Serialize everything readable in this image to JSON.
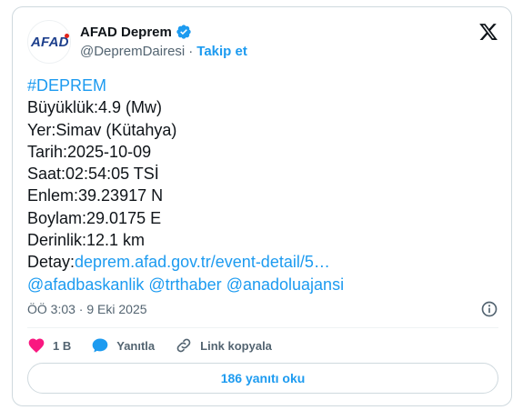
{
  "header": {
    "avatar_text": "AFAD",
    "display_name": "AFAD Deprem",
    "handle": "@DepremDairesi",
    "separator": "·",
    "follow_label": "Takip et"
  },
  "tweet": {
    "hashtag": "#DEPREM",
    "magnitude": "Büyüklük:4.9 (Mw)",
    "location": "Yer:Simav (Kütahya)",
    "date": "Tarih:2025-10-09",
    "time": "Saat:02:54:05 TSİ",
    "latitude": "Enlem:39.23917 N",
    "longitude": "Boylam:29.0175 E",
    "depth": "Derinlik:12.1 km",
    "detail_prefix": "Detay:",
    "detail_link": "deprem.afad.gov.tr/event-detail/5…",
    "mentions": [
      "@afadbaskanlik",
      "@trthaber",
      "@anadoluajansi"
    ]
  },
  "timestamp": "ÖÖ 3:03 · 9 Eki 2025",
  "actions": {
    "like_count": "1 B",
    "reply_label": "Yanıtla",
    "copy_link_label": "Link kopyala"
  },
  "read_replies_label": "186 yanıtı oku",
  "colors": {
    "accent": "#1d9bf0",
    "like": "#f91880",
    "text": "#0f1419",
    "muted": "#536471",
    "border": "#cfd9de"
  }
}
